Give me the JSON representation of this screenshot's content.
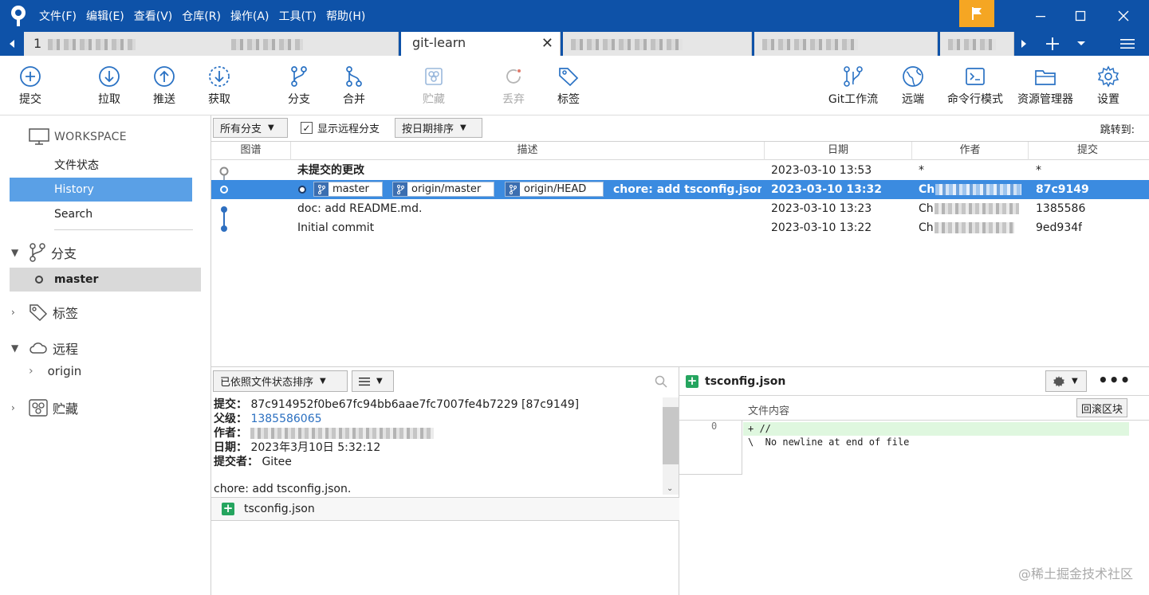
{
  "menu": [
    "文件(F)",
    "编辑(E)",
    "查看(V)",
    "仓库(R)",
    "操作(A)",
    "工具(T)",
    "帮助(H)"
  ],
  "tabs": {
    "first_prefix": "1",
    "active": "git-learn"
  },
  "toolbar": {
    "commit": "提交",
    "pull": "拉取",
    "push": "推送",
    "fetch": "获取",
    "branch": "分支",
    "merge": "合并",
    "stash": "贮藏",
    "discard": "丢弃",
    "tag": "标签",
    "git_flow": "Git工作流",
    "remote": "远端",
    "terminal": "命令行模式",
    "explorer": "资源管理器",
    "settings": "设置"
  },
  "sidebar": {
    "workspace": "WORKSPACE",
    "file_status": "文件状态",
    "history": "History",
    "search": "Search",
    "branches": "分支",
    "branch_master": "master",
    "tags": "标签",
    "remotes": "远程",
    "remote_origin": "origin",
    "stashes": "贮藏"
  },
  "filter": {
    "all_branches": "所有分支",
    "show_remote": "显示远程分支",
    "sort_by_date": "按日期排序",
    "jump_to": "跳转到:"
  },
  "history": {
    "columns": [
      "图谱",
      "描述",
      "日期",
      "作者",
      "提交"
    ],
    "uncommitted": {
      "desc": "未提交的更改",
      "date": "2023-03-10 13:53",
      "author": "*",
      "commit": "*"
    },
    "refs": [
      "master",
      "origin/master",
      "origin/HEAD"
    ],
    "rows": [
      {
        "desc": "chore: add tsconfig.json.",
        "date": "2023-03-10 13:32",
        "author_prefix": "Ch",
        "commit": "87c9149"
      },
      {
        "desc": "doc: add README.md.",
        "date": "2023-03-10 13:23",
        "author_prefix": "Ch",
        "commit": "1385586"
      },
      {
        "desc": "Initial commit",
        "date": "2023-03-10 13:22",
        "author_prefix": "Ch",
        "commit": "9ed934f"
      }
    ]
  },
  "details": {
    "sort_label": "已依照文件状态排序",
    "commit_key": "提交：",
    "commit_val": "87c914952f0be67fc94bb6aae7fc7007fe4b7229 [87c9149]",
    "parent_key": "父级：",
    "parent_val": "1385586065",
    "author_key": "作者：",
    "date_key": "日期：",
    "date_val": "2023年3月10日 5:32:12",
    "committer_key": "提交者：",
    "committer_val": "Gitee",
    "message": "chore: add tsconfig.json.",
    "file": "tsconfig.json"
  },
  "diff": {
    "file": "tsconfig.json",
    "content_label": "文件内容",
    "rollback": "回滚区块",
    "line_no": "0",
    "lines": [
      "+ //",
      "\\  No newline at end of file"
    ],
    "added_bg": "#dff7df"
  },
  "watermark": "@稀土掘金技术社区",
  "colors": {
    "titlebar": "#0e52a8",
    "selection": "#3b8be0",
    "flag": "#f5a623"
  }
}
